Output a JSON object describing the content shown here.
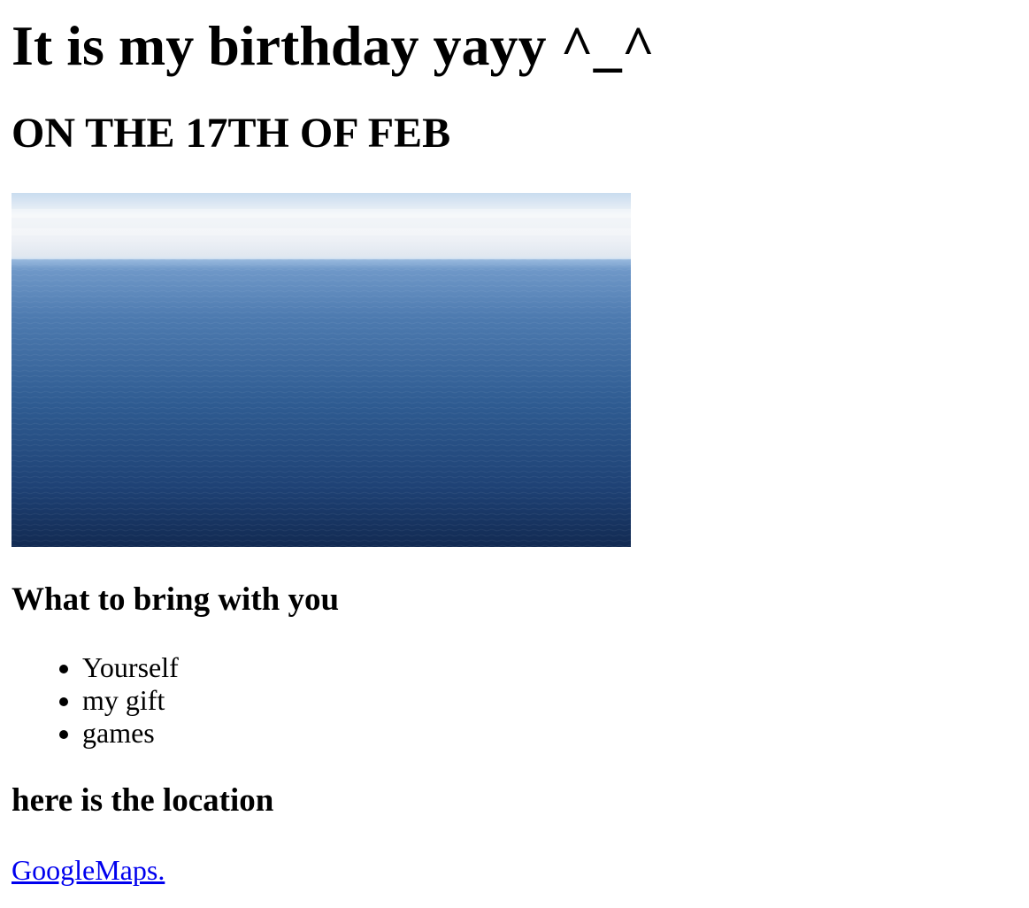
{
  "heading": "It is my birthday yayy ^_^",
  "date_heading": "ON THE 17TH OF FEB",
  "image": {
    "subject": "ocean-horizon-photo",
    "colors": {
      "sky_top": "#cfdff0",
      "sky_mid": "#eef3f7",
      "horizon": "#8fb3da",
      "sea_top": "#4f7fb5",
      "sea_bottom": "#13284f"
    }
  },
  "bring_section": {
    "title": "What to bring with you",
    "items": [
      "Yourself",
      "my gift",
      "games"
    ]
  },
  "location_section": {
    "title": "here is the location",
    "link_text": "GoogleMaps."
  },
  "colors": {
    "link": "#0000ee",
    "text": "#000000",
    "background": "#ffffff"
  }
}
